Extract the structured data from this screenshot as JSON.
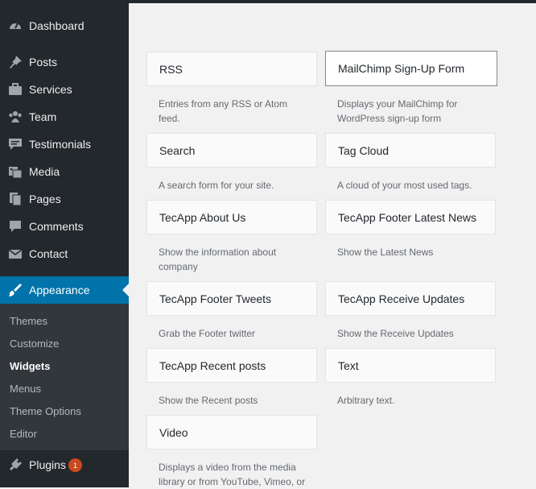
{
  "sidebar": {
    "menu": [
      {
        "label": "Dashboard",
        "icon": "dashboard-icon"
      },
      {
        "label": "Posts",
        "icon": "pin-icon"
      },
      {
        "label": "Services",
        "icon": "briefcase-icon"
      },
      {
        "label": "Team",
        "icon": "groups-icon"
      },
      {
        "label": "Testimonials",
        "icon": "testimonial-icon"
      },
      {
        "label": "Media",
        "icon": "media-icon"
      },
      {
        "label": "Pages",
        "icon": "pages-icon"
      },
      {
        "label": "Comments",
        "icon": "comment-icon"
      },
      {
        "label": "Contact",
        "icon": "mail-icon"
      },
      {
        "label": "Appearance",
        "icon": "brush-icon"
      }
    ],
    "submenu": [
      "Themes",
      "Customize",
      "Widgets",
      "Menus",
      "Theme Options",
      "Editor"
    ],
    "plugins": {
      "label": "Plugins",
      "badge": "1",
      "icon": "plugin-icon"
    }
  },
  "widgets": [
    {
      "title": "RSS",
      "desc": "Entries from any RSS or Atom feed."
    },
    {
      "title": "MailChimp Sign-Up Form",
      "desc": "Displays your MailChimp for WordPress sign-up form"
    },
    {
      "title": "Search",
      "desc": "A search form for your site."
    },
    {
      "title": "Tag Cloud",
      "desc": "A cloud of your most used tags."
    },
    {
      "title": "TecApp About Us",
      "desc": "Show the information about company"
    },
    {
      "title": "TecApp Footer Latest News",
      "desc": "Show the Latest News"
    },
    {
      "title": "TecApp Footer Tweets",
      "desc": "Grab the Footer twitter"
    },
    {
      "title": "TecApp Receive Updates",
      "desc": "Show the Receive Updates"
    },
    {
      "title": "TecApp Recent posts",
      "desc": "Show the Recent posts"
    },
    {
      "title": "Text",
      "desc": "Arbitrary text."
    },
    {
      "title": "Video",
      "desc": "Displays a video from the media library or from YouTube, Vimeo, or"
    }
  ],
  "colors": {
    "sidebar": "#23282d",
    "submenu": "#32373c",
    "active": "#0073aa",
    "badge": "#ca4a1f"
  }
}
